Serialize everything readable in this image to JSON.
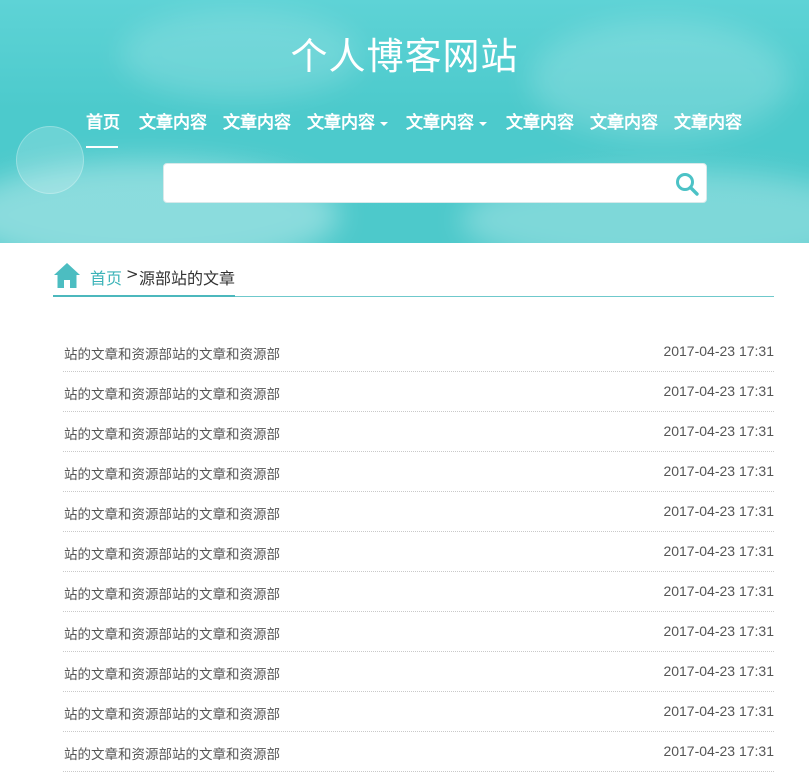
{
  "site": {
    "title": "个人博客网站"
  },
  "nav": {
    "items": [
      {
        "label": "首页",
        "dropdown": false,
        "active": true
      },
      {
        "label": "文章内容",
        "dropdown": false
      },
      {
        "label": "文章内容",
        "dropdown": false
      },
      {
        "label": "文章内容",
        "dropdown": true
      },
      {
        "label": "文章内容",
        "dropdown": true
      },
      {
        "label": "文章内容",
        "dropdown": false
      },
      {
        "label": "文章内容",
        "dropdown": false
      },
      {
        "label": "文章内容",
        "dropdown": false
      }
    ]
  },
  "search": {
    "value": "",
    "placeholder": "",
    "icon": "search-icon"
  },
  "breadcrumb": {
    "home": "首页",
    "separator": ">",
    "current": "源部站的文章"
  },
  "articles": [
    {
      "title": "站的文章和资源部站的文章和资源部",
      "date": "2017-04-23 17:31"
    },
    {
      "title": "站的文章和资源部站的文章和资源部",
      "date": "2017-04-23 17:31"
    },
    {
      "title": "站的文章和资源部站的文章和资源部",
      "date": "2017-04-23 17:31"
    },
    {
      "title": "站的文章和资源部站的文章和资源部",
      "date": "2017-04-23 17:31"
    },
    {
      "title": "站的文章和资源部站的文章和资源部",
      "date": "2017-04-23 17:31"
    },
    {
      "title": "站的文章和资源部站的文章和资源部",
      "date": "2017-04-23 17:31"
    },
    {
      "title": "站的文章和资源部站的文章和资源部",
      "date": "2017-04-23 17:31"
    },
    {
      "title": "站的文章和资源部站的文章和资源部",
      "date": "2017-04-23 17:31"
    },
    {
      "title": "站的文章和资源部站的文章和资源部",
      "date": "2017-04-23 17:31"
    },
    {
      "title": "站的文章和资源部站的文章和资源部",
      "date": "2017-04-23 17:31"
    },
    {
      "title": "站的文章和资源部站的文章和资源部",
      "date": "2017-04-23 17:31"
    }
  ],
  "colors": {
    "accent": "#4cc9cc",
    "link": "#3bb3b8",
    "text": "#555555"
  }
}
